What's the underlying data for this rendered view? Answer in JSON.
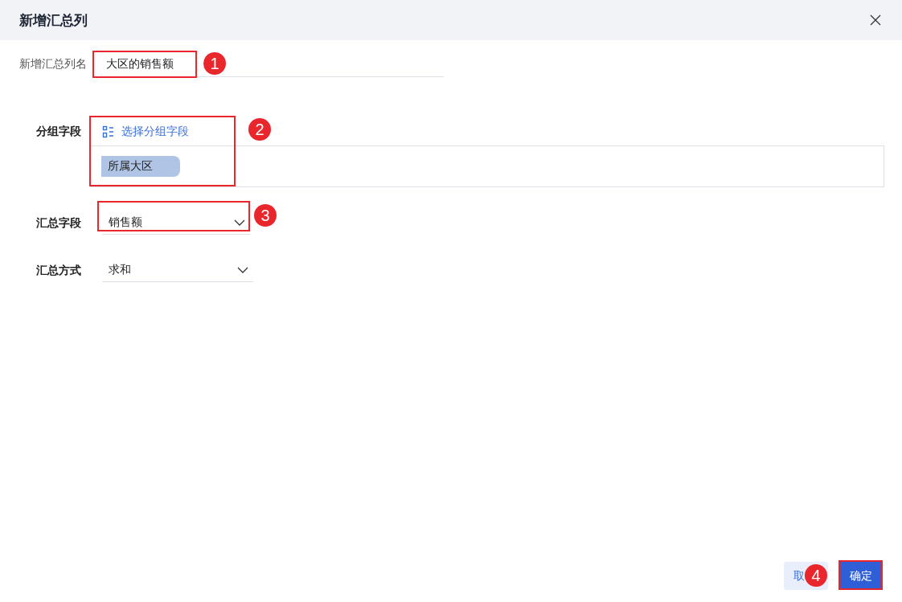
{
  "dialog": {
    "title": "新增汇总列"
  },
  "name_field": {
    "label": "新增汇总列名",
    "value": "大区的销售额"
  },
  "group_field": {
    "label": "分组字段",
    "link": "选择分组字段",
    "tags": [
      "所属大区"
    ]
  },
  "summary_field": {
    "label": "汇总字段",
    "value": "销售额"
  },
  "summary_method": {
    "label": "汇总方式",
    "value": "求和"
  },
  "buttons": {
    "cancel": "取",
    "ok": "确定"
  },
  "annotations": [
    {
      "number": "1"
    },
    {
      "number": "2"
    },
    {
      "number": "3"
    },
    {
      "number": "4"
    }
  ]
}
